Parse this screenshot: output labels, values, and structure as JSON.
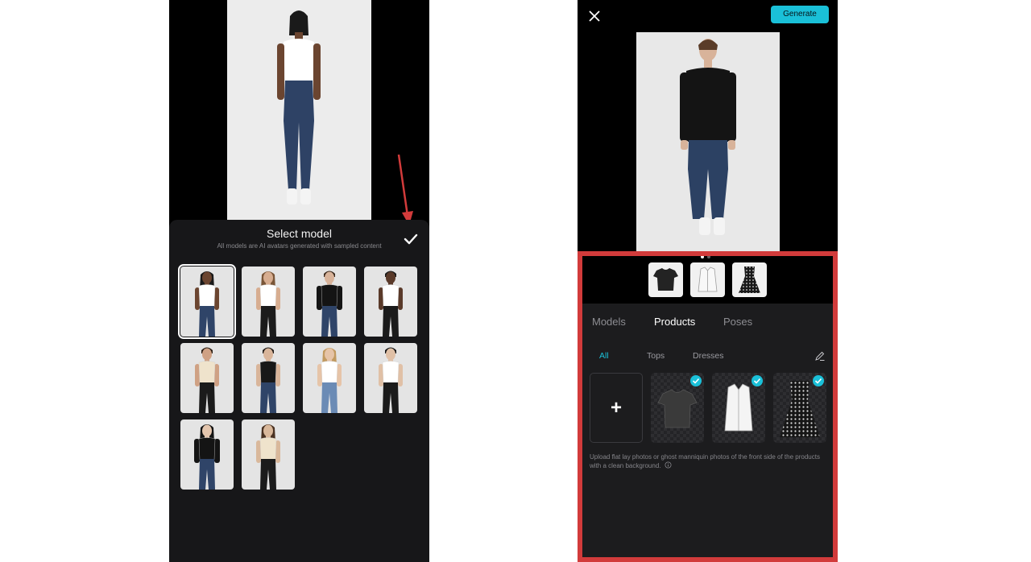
{
  "left_screen": {
    "sheet": {
      "title": "Select model",
      "subtitle": "All models are AI avatars generated with sampled content",
      "confirm_icon": "checkmark-icon"
    },
    "annotation": {
      "arrow_color": "#d23b3b"
    },
    "models": [
      {
        "top": "white-tank",
        "bottom": "blue-jeans",
        "skin": "#6b4530",
        "hair": "#1a1a1a",
        "gender": "f",
        "selected": true
      },
      {
        "top": "white-tank",
        "bottom": "black-jeans",
        "skin": "#d7ad90",
        "hair": "#7a5638",
        "gender": "f",
        "selected": false
      },
      {
        "top": "black-sweater",
        "bottom": "blue-jeans",
        "skin": "#d8b39a",
        "hair": "#3b2a1d",
        "gender": "m",
        "selected": false
      },
      {
        "top": "white-tee",
        "bottom": "black-jeans",
        "skin": "#5a3a2a",
        "hair": "#1a1a1a",
        "gender": "m",
        "selected": false
      },
      {
        "top": "cream-tee",
        "bottom": "black-jeans",
        "skin": "#cfa184",
        "hair": "#2a1d14",
        "gender": "m",
        "selected": false
      },
      {
        "top": "black-tee",
        "bottom": "blue-jeans",
        "skin": "#d9b59a",
        "hair": "#1f1a17",
        "gender": "m",
        "selected": false
      },
      {
        "top": "white-tee",
        "bottom": "light-jeans",
        "skin": "#e6c4a8",
        "hair": "#c29a60",
        "gender": "f",
        "selected": false
      },
      {
        "top": "white-tee",
        "bottom": "black-jeans",
        "skin": "#e0c0a6",
        "hair": "#141414",
        "gender": "m",
        "selected": false
      },
      {
        "top": "black-sweater",
        "bottom": "blue-jeans",
        "skin": "#e4c6ae",
        "hair": "#141414",
        "gender": "f",
        "selected": false
      },
      {
        "top": "cream-tee",
        "bottom": "black-jeans",
        "skin": "#d9b89b",
        "hair": "#4a3222",
        "gender": "f",
        "selected": false
      }
    ]
  },
  "right_screen": {
    "header": {
      "close_icon": "close-icon",
      "generate_label": "Generate"
    },
    "carousel": {
      "dot_count": 2,
      "active_dot": 0
    },
    "selected_products": [
      "tshirt-icon",
      "shirt-icon",
      "dress-icon"
    ],
    "tabs": [
      {
        "label": "Models",
        "active": false
      },
      {
        "label": "Products",
        "active": true
      },
      {
        "label": "Poses",
        "active": false
      }
    ],
    "filters": [
      {
        "label": "All",
        "active": true
      },
      {
        "label": "Tops",
        "active": false
      },
      {
        "label": "Dresses",
        "active": false
      }
    ],
    "edit_icon": "pencil-icon",
    "upload_label": "+",
    "products": [
      {
        "kind": "tshirt",
        "checked": true
      },
      {
        "kind": "shirt",
        "checked": true
      },
      {
        "kind": "dress",
        "checked": true
      }
    ],
    "hint": "Upload flat lay photos or ghost manniquin photos of the front side of the products with a clean background.",
    "info_icon": "info-icon",
    "annotation_color": "#d23b3b",
    "accent_color": "#1ac0d8"
  }
}
